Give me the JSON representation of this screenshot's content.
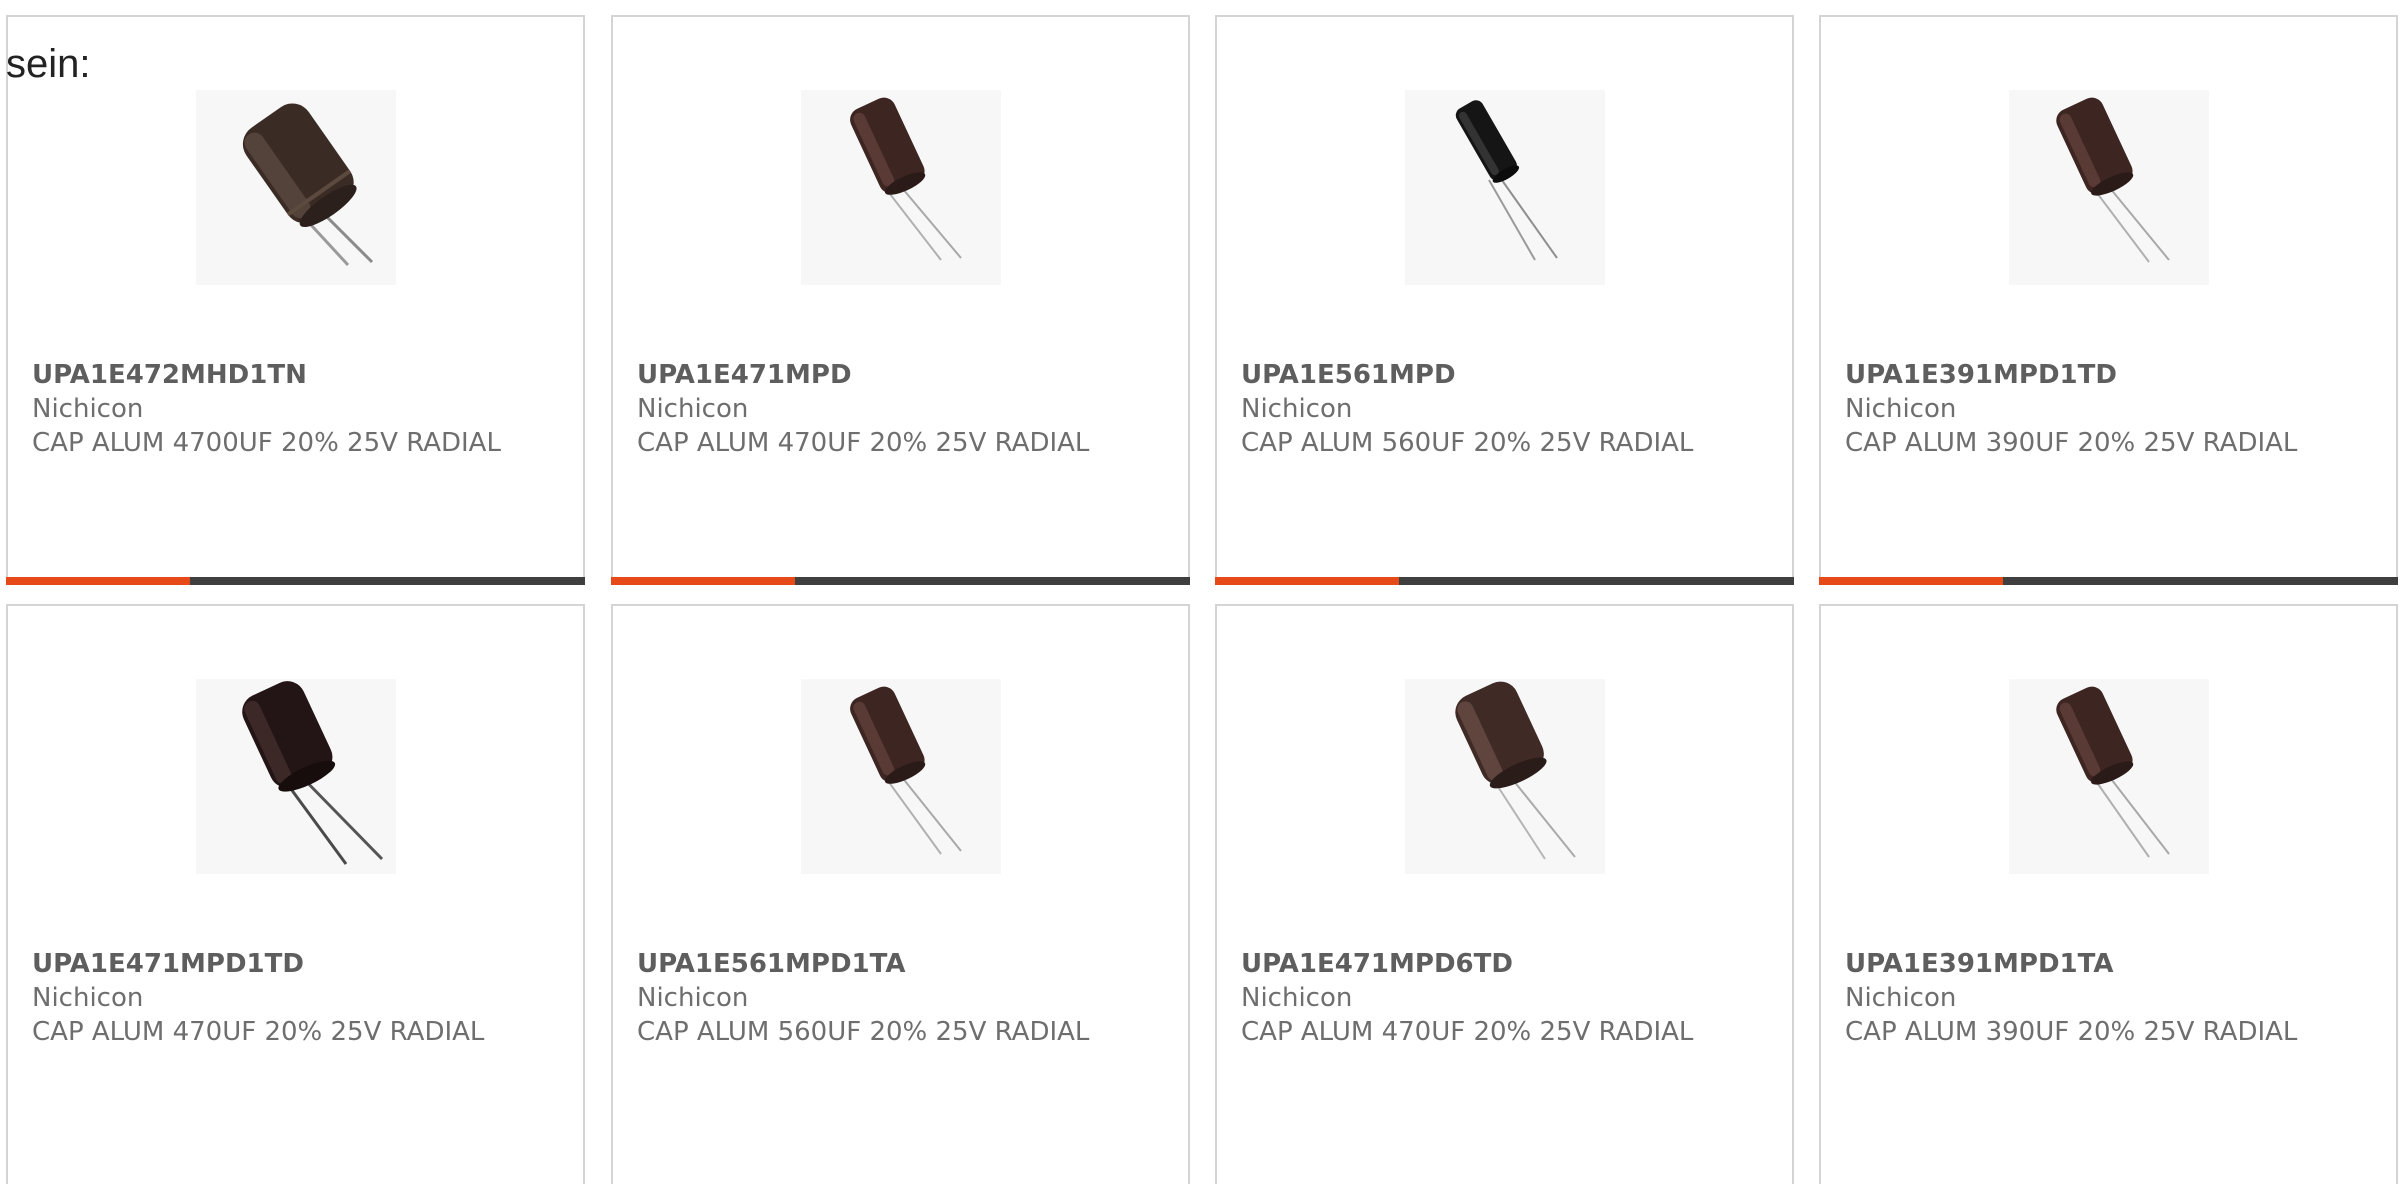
{
  "intro_text": "sein:",
  "colors": {
    "accent": "#e64a19",
    "bar_dark": "#3f3f3f",
    "border": "#d4d4d4",
    "text": "#6e6e6e"
  },
  "products": [
    {
      "part_number": "UPA1E472MHD1TN",
      "manufacturer": "Nichicon",
      "description": "CAP ALUM 4700UF 20% 25V RADIAL",
      "image_icon": "radial-capacitor-icon"
    },
    {
      "part_number": "UPA1E471MPD",
      "manufacturer": "Nichicon",
      "description": "CAP ALUM 470UF 20% 25V RADIAL",
      "image_icon": "radial-capacitor-icon"
    },
    {
      "part_number": "UPA1E561MPD",
      "manufacturer": "Nichicon",
      "description": "CAP ALUM 560UF 20% 25V RADIAL",
      "image_icon": "radial-capacitor-icon"
    },
    {
      "part_number": "UPA1E391MPD1TD",
      "manufacturer": "Nichicon",
      "description": "CAP ALUM 390UF 20% 25V RADIAL",
      "image_icon": "radial-capacitor-icon"
    },
    {
      "part_number": "UPA1E471MPD1TD",
      "manufacturer": "Nichicon",
      "description": "CAP ALUM 470UF 20% 25V RADIAL",
      "image_icon": "radial-capacitor-icon"
    },
    {
      "part_number": "UPA1E561MPD1TA",
      "manufacturer": "Nichicon",
      "description": "CAP ALUM 560UF 20% 25V RADIAL",
      "image_icon": "radial-capacitor-icon"
    },
    {
      "part_number": "UPA1E471MPD6TD",
      "manufacturer": "Nichicon",
      "description": "CAP ALUM 470UF 20% 25V RADIAL",
      "image_icon": "radial-capacitor-icon"
    },
    {
      "part_number": "UPA1E391MPD1TA",
      "manufacturer": "Nichicon",
      "description": "CAP ALUM 390UF 20% 25V RADIAL",
      "image_icon": "radial-capacitor-icon"
    }
  ]
}
